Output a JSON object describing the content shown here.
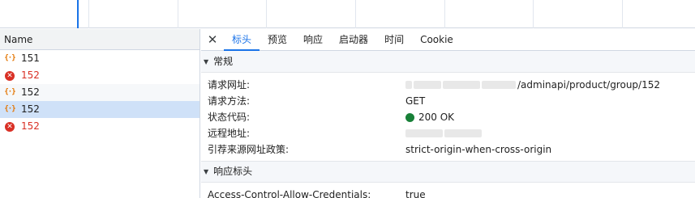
{
  "request_list": {
    "header": "Name",
    "items": [
      {
        "name": "151",
        "icon": "json-icon",
        "error": false
      },
      {
        "name": "152",
        "icon": "error-icon",
        "error": true
      },
      {
        "name": "152",
        "icon": "json-icon",
        "error": false
      },
      {
        "name": "152",
        "icon": "json-icon",
        "error": false,
        "selected": true
      },
      {
        "name": "152",
        "icon": "error-icon",
        "error": true
      }
    ]
  },
  "tabs": {
    "close": "✕",
    "items": [
      "标头",
      "预览",
      "响应",
      "启动器",
      "时间",
      "Cookie"
    ],
    "active": "标头"
  },
  "general": {
    "title": "常规",
    "rows": [
      {
        "key": "请求网址:",
        "value": "/adminapi/product/group/152"
      },
      {
        "key": "请求方法:",
        "value": "GET"
      },
      {
        "key": "状态代码:",
        "value": "200 OK"
      },
      {
        "key": "远程地址:",
        "value": ""
      },
      {
        "key": "引荐来源网址政策:",
        "value": "strict-origin-when-cross-origin"
      }
    ]
  },
  "response_headers": {
    "title": "响应标头",
    "rows": [
      {
        "key": "Access-Control-Allow-Credentials:",
        "value": "true"
      }
    ]
  },
  "colors": {
    "accent": "#1a73e8",
    "error": "#d93025",
    "success": "#188038",
    "json": "#e37400"
  }
}
